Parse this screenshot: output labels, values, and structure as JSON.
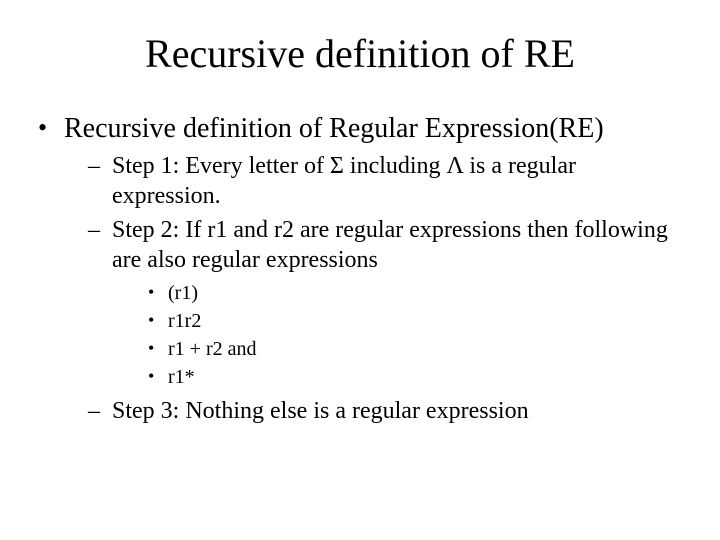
{
  "title": "Recursive definition of RE",
  "bullet1": "Recursive definition of Regular Expression(RE)",
  "step1": "Step 1: Every letter of Σ including Λ is a regular expression.",
  "step2": "Step 2: If r1 and r2 are regular expressions then following are also regular expressions",
  "sub1": "(r1)",
  "sub2": "r1r2",
  "sub3": "r1 + r2 and",
  "sub4": "r1*",
  "step3": "Step 3: Nothing else is a regular expression"
}
